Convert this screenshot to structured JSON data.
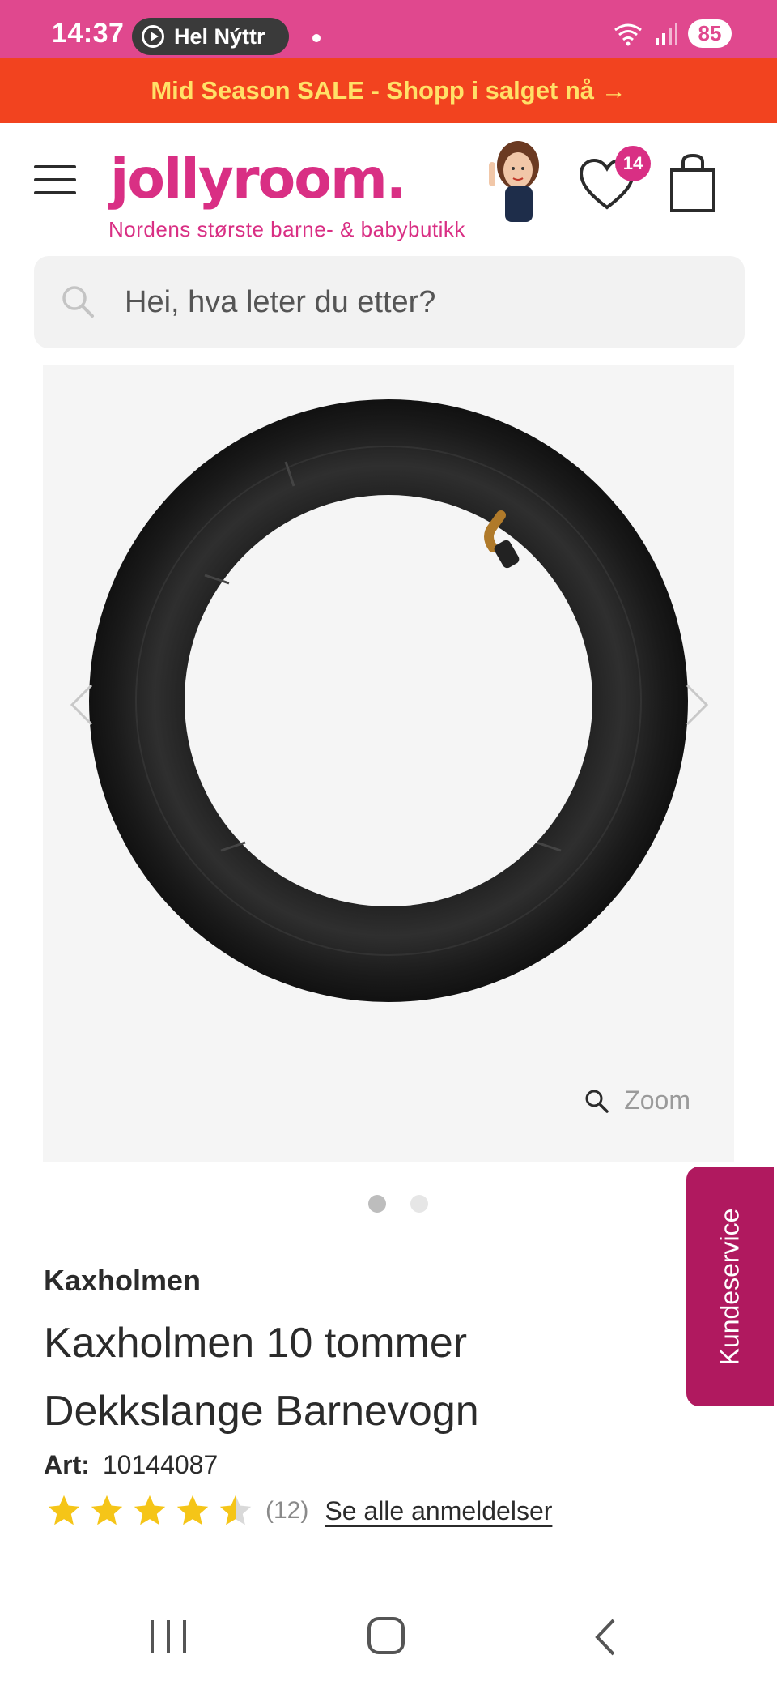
{
  "status_bar": {
    "time": "14:37",
    "media_label": "Hel Nýttr",
    "battery": "85"
  },
  "sale_banner": {
    "text": "Mid Season SALE - Shopp i salget nå →"
  },
  "header": {
    "logo": "jollyroom.",
    "tagline": "Nordens største barne- & babybutikk",
    "wishlist_count": "14"
  },
  "search": {
    "placeholder": "Hei, hva leter du etter?"
  },
  "gallery": {
    "zoom_label": "Zoom",
    "image_count": 2,
    "active_index": 0
  },
  "customer_service": {
    "label": "Kundeservice"
  },
  "product": {
    "brand": "Kaxholmen",
    "title": "Kaxholmen 10 tommer Dekkslange Barnevogn",
    "art_label": "Art:",
    "art_number": "10144087",
    "rating": 4.5,
    "review_count": "(12)",
    "reviews_link": "Se alle anmeldelser"
  },
  "colors": {
    "status_bar": "#e0488e",
    "sale_banner": "#f2431f",
    "sale_text": "#ffe168",
    "brand_pink": "#d92f84",
    "kundeservice": "#b0195f",
    "star": "#f5c518"
  }
}
